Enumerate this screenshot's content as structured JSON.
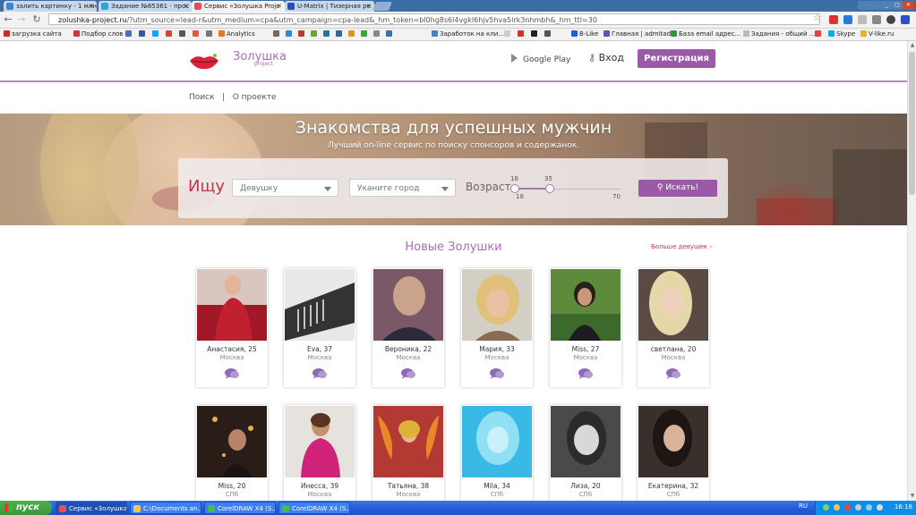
{
  "browser": {
    "tabs": [
      {
        "label": "залить картинку - 1 млн",
        "color": "#3b84d8"
      },
      {
        "label": "Задание №85361 - прос",
        "color": "#2aa6d8"
      },
      {
        "label": "Сервис «Золушка Proje",
        "color": "#e84a5f"
      },
      {
        "label": "U-Matrix | Тизерная ре",
        "color": "#2b4fbf"
      }
    ],
    "window_buttons": [
      "bcc-mark"
    ],
    "url_domain": "zolushka-project.ru",
    "url_rest": "/?utm_source=lead-r&utm_medium=cpa&utm_campaign=cpa-lead&_hm_token=bl0hg8s6l4vgkl6hjv5hva5lrk3nhmbh&_hm_ttl=30",
    "bookmarks": [
      {
        "label": "загрузка сайта",
        "color": "#cc2a2a"
      },
      {
        "label": "Подбор слов",
        "color": "#c03e3e"
      },
      {
        "label": "",
        "color": "#4a6fb5"
      },
      {
        "label": "",
        "color": "#3b5998"
      },
      {
        "label": "",
        "color": "#1da1f2"
      },
      {
        "label": "",
        "color": "#db4437"
      },
      {
        "label": "",
        "color": "#555"
      },
      {
        "label": "",
        "color": "#e53"
      },
      {
        "label": "",
        "color": "#777"
      },
      {
        "label": "Analytics",
        "color": "#e87b1e"
      },
      {
        "label": "",
        "color": "#6d6d6d"
      },
      {
        "label": "",
        "color": "#2a8bd8"
      },
      {
        "label": "",
        "color": "#c33"
      },
      {
        "label": "",
        "color": "#6a3"
      },
      {
        "label": "",
        "color": "#27a"
      },
      {
        "label": "",
        "color": "#369"
      },
      {
        "label": "",
        "color": "#d90"
      },
      {
        "label": "",
        "color": "#3a3"
      },
      {
        "label": "",
        "color": "#888"
      },
      {
        "label": "",
        "color": "#37a"
      },
      {
        "label": "Заработок на кли...",
        "color": "#4680c2"
      },
      {
        "label": "",
        "color": "#ccc"
      },
      {
        "label": "",
        "color": "#c33"
      },
      {
        "label": "",
        "color": "#222"
      },
      {
        "label": "",
        "color": "#555"
      },
      {
        "label": "B-Like",
        "color": "#1f5fd6"
      },
      {
        "label": "Главная | admitad",
        "color": "#6a4fb3"
      },
      {
        "label": "База email адрес...",
        "color": "#2b9b3b"
      },
      {
        "label": "Задания - общий ...",
        "color": "#bbb"
      },
      {
        "label": "",
        "color": "#d44"
      },
      {
        "label": "Skype",
        "color": "#00aff0"
      },
      {
        "label": "V-like.ru",
        "color": "#e8b41e"
      }
    ]
  },
  "site": {
    "logo_text": "Золушка",
    "logo_sub": "project",
    "google_play": "Google Play",
    "login": "Вход",
    "register": "Регистрация",
    "subnav": "Поиск   |   О проекте",
    "hero_title": "Знакомства для успешных мужчин",
    "hero_subtitle": "Лучший on-line сервис по поиску спонсоров и содержанок.",
    "search": {
      "label": "Ищу",
      "gender": "Девушку",
      "city": "Уканите город",
      "age_label": "Возраст",
      "age_min_top": "18",
      "age_max_top": "35",
      "age_min": "18",
      "age_max": "70",
      "age_range_min": 18,
      "age_range_max": 35,
      "age_scale_min": 18,
      "age_scale_max": 70,
      "button": "Искать!"
    },
    "section_title": "Новые Золушки",
    "more_link": "Больше девушек",
    "profiles_row1": [
      {
        "name": "Анастасия, 25",
        "city": "Москва"
      },
      {
        "name": "Eva, 37",
        "city": "Москва"
      },
      {
        "name": "Вероника, 22",
        "city": "Москва"
      },
      {
        "name": "Мария, 33",
        "city": "Москва"
      },
      {
        "name": "Miss, 27",
        "city": "Москва"
      },
      {
        "name": "светлана, 20",
        "city": "Москва"
      }
    ],
    "profiles_row2": [
      {
        "name": "Miss, 20",
        "city": "СПб"
      },
      {
        "name": "Инесса, 39",
        "city": "Москва"
      },
      {
        "name": "Татьяна, 38",
        "city": "Москва"
      },
      {
        "name": "Mila, 34",
        "city": "СПб"
      },
      {
        "name": "Лиза, 20",
        "city": "СПб"
      },
      {
        "name": "Екатерина, 32",
        "city": "СПб"
      }
    ]
  },
  "taskbar": {
    "start": "пуск",
    "items": [
      {
        "label": "Сервис «Золушка...",
        "color": "#e84a5f"
      },
      {
        "label": "C:\\Documents an...",
        "color": "#f3c64a"
      },
      {
        "label": "CorelDRAW X4 (S...",
        "color": "#4db84d"
      },
      {
        "label": "CorelDRAW X4 (S...",
        "color": "#4db84d"
      }
    ],
    "language": "RU",
    "clock": "16:18"
  }
}
